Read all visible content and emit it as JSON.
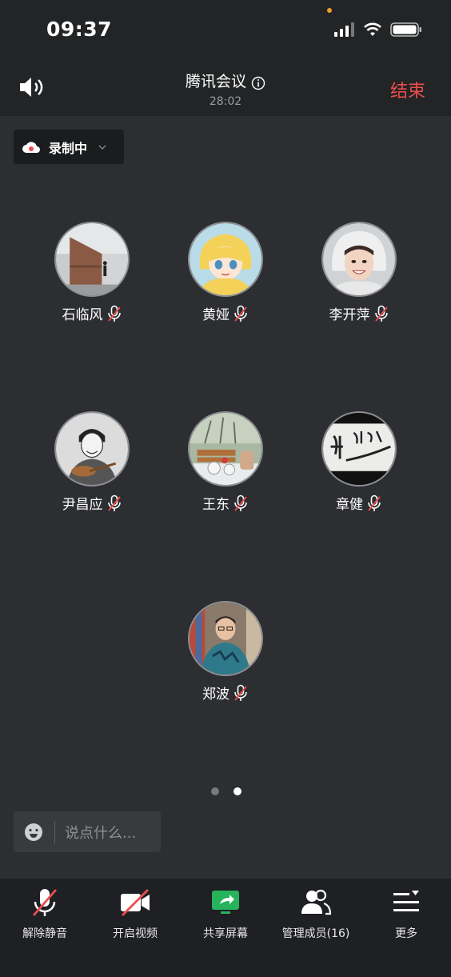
{
  "status_bar": {
    "time": "09:37"
  },
  "header": {
    "title": "腾讯会议",
    "duration": "28:02",
    "end_label": "结束"
  },
  "recording": {
    "label": "录制中"
  },
  "participants": [
    {
      "name": "石临风",
      "muted": true
    },
    {
      "name": "黄娅",
      "muted": true
    },
    {
      "name": "李开萍",
      "muted": true
    },
    {
      "name": "尹昌应",
      "muted": true
    },
    {
      "name": "王东",
      "muted": true
    },
    {
      "name": "章健",
      "muted": true
    },
    {
      "name": "郑波",
      "muted": true
    }
  ],
  "pagination": {
    "pages": 2,
    "current": 2
  },
  "chat": {
    "placeholder": "说点什么..."
  },
  "toolbar": {
    "unmute": "解除静音",
    "video": "开启视频",
    "share": "共享屏幕",
    "members": "管理成员(16)",
    "more": "更多"
  },
  "colors": {
    "end": "#ee4d4d",
    "share": "#27b35c",
    "recording": "#ee4d4d"
  },
  "icons": [
    "speaker-icon",
    "info-icon",
    "cloud-record-icon",
    "chevron-down-icon",
    "mic-muted-icon",
    "emoji-icon",
    "video-off-icon",
    "share-screen-icon",
    "members-icon",
    "more-icon"
  ]
}
